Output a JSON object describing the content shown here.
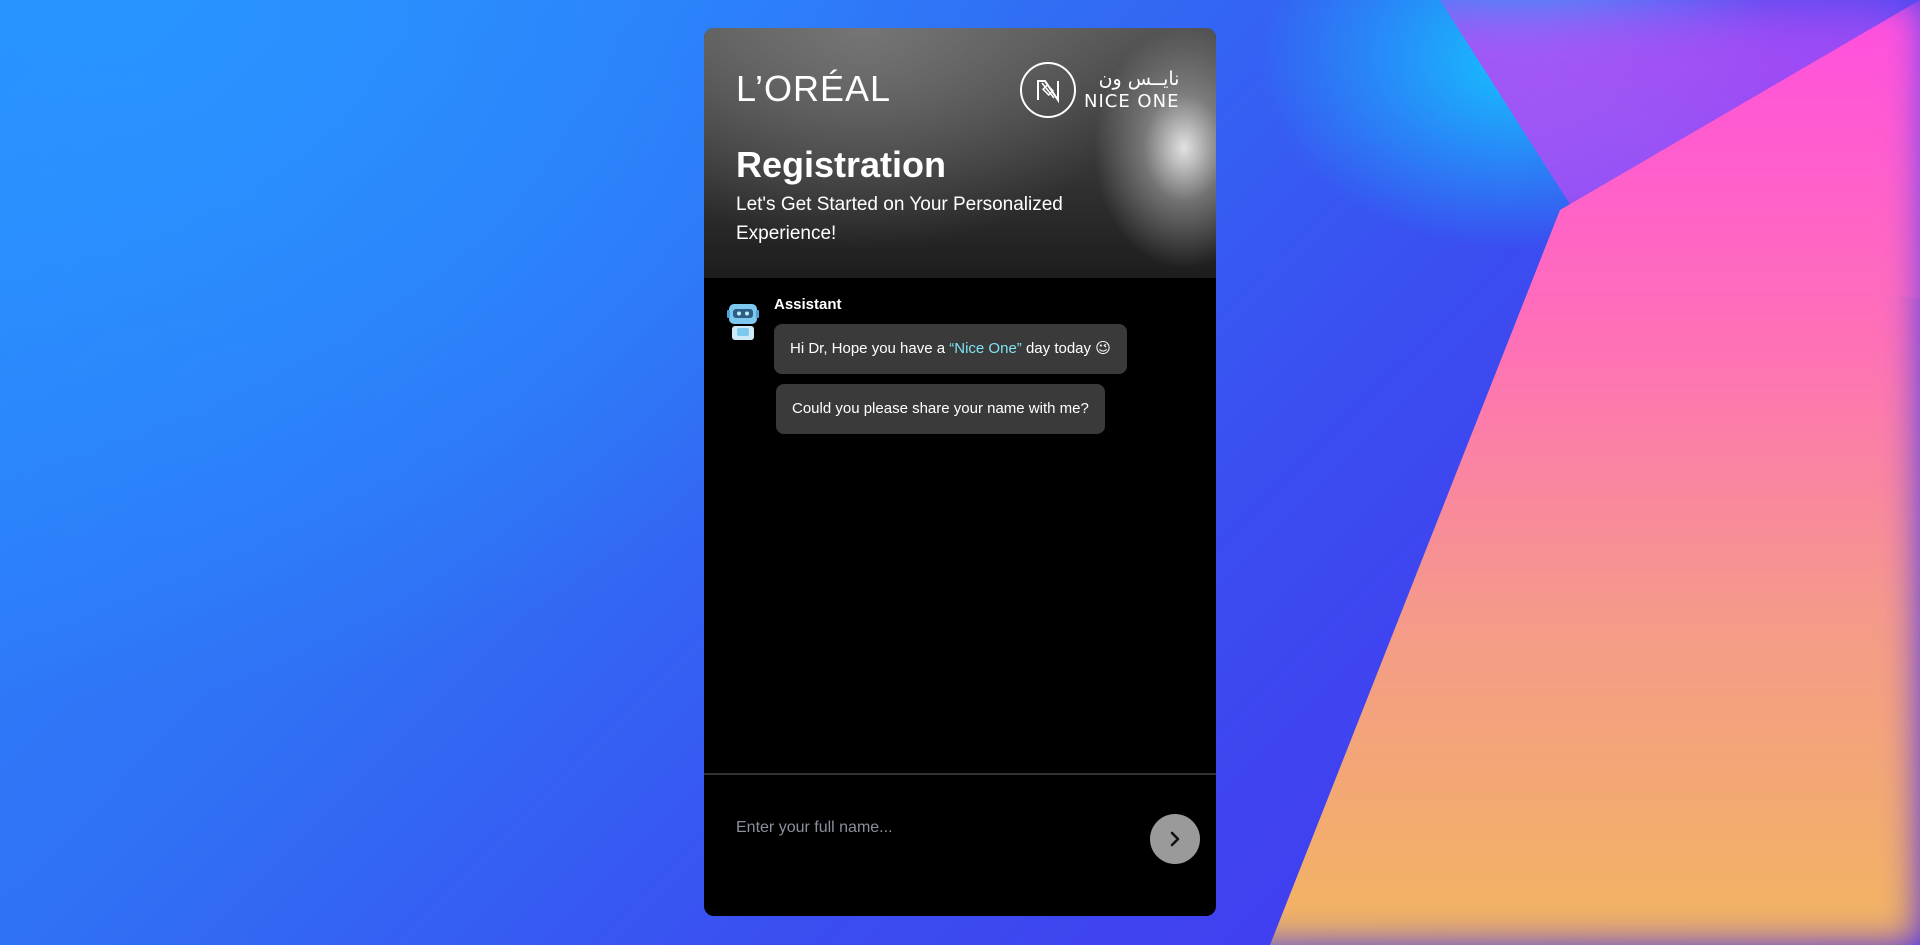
{
  "brand": {
    "loreal_logo": "L’ORÉAL",
    "nice_one_arabic": "نايــس ون",
    "nice_one_latin": "NICE ONE"
  },
  "header": {
    "title": "Registration",
    "subtitle": "Let's Get Started on Your Personalized Experience!"
  },
  "chat": {
    "sender": "Assistant",
    "avatar_icon": "robot-avatar-icon",
    "messages": [
      {
        "prefix": "Hi Dr, Hope you have a ",
        "highlight": "“Nice One”",
        "suffix": " day today ",
        "emoji": "😉"
      },
      {
        "text": "Could you please share your name with me?"
      }
    ]
  },
  "composer": {
    "placeholder": "Enter your full name...",
    "value": "",
    "send_icon": "chevron-right-icon"
  },
  "colors": {
    "panel_bg": "#000000",
    "bubble_bg": "#3a3a3a",
    "highlight": "#7fe3f0",
    "send_button": "#9a9a9a"
  }
}
